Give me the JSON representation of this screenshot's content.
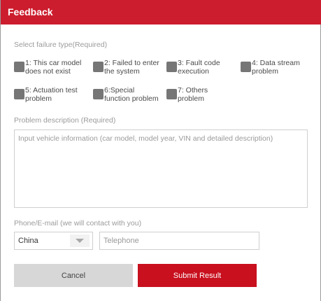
{
  "header": {
    "title": "Feedback"
  },
  "failure_type": {
    "label": "Select failure type(Required)",
    "options": [
      {
        "label": "1: This car model\ndoes not exist"
      },
      {
        "label": "2: Failed to enter\nthe system"
      },
      {
        "label": "3: Fault code\nexecution"
      },
      {
        "label": "4: Data stream\nproblem"
      },
      {
        "label": "5: Actuation test\nproblem"
      },
      {
        "label": "6:Special\nfunction problem"
      },
      {
        "label": "7: Others\nproblem"
      }
    ]
  },
  "description": {
    "label": "Problem description (Required)",
    "placeholder": "Input vehicle information (car model, model year, VIN and detailed description)"
  },
  "contact": {
    "label": "Phone/E-mail (we will contact with you)",
    "country": "China",
    "phone_placeholder": "Telephone"
  },
  "buttons": {
    "cancel": "Cancel",
    "submit": "Submit Result"
  },
  "colors": {
    "header": "#cc1d2e",
    "submit": "#c8101e",
    "cancel": "#d7d7d7",
    "checkbox": "#767676"
  }
}
